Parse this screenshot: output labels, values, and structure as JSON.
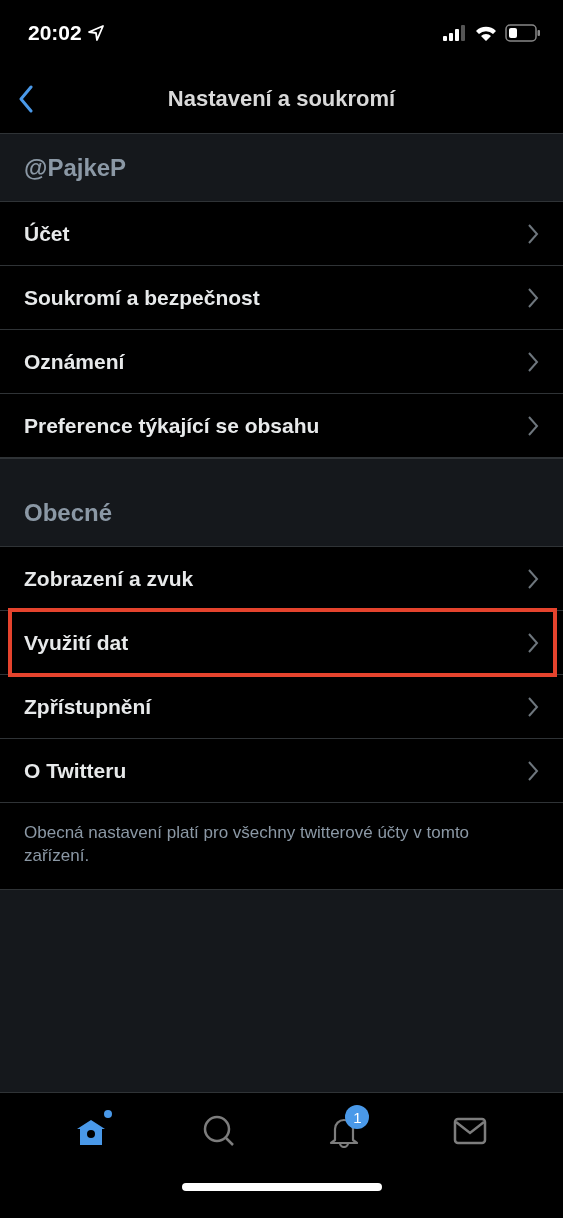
{
  "status_bar": {
    "time": "20:02"
  },
  "nav": {
    "title": "Nastavení a soukromí"
  },
  "sections": [
    {
      "header": "@PajkeP",
      "items": [
        {
          "label": "Účet",
          "highlighted": false
        },
        {
          "label": "Soukromí a bezpečnost",
          "highlighted": false
        },
        {
          "label": "Oznámení",
          "highlighted": false
        },
        {
          "label": "Preference týkající se obsahu",
          "highlighted": false
        }
      ]
    },
    {
      "header": "Obecné",
      "items": [
        {
          "label": "Zobrazení a zvuk",
          "highlighted": false
        },
        {
          "label": "Využití dat",
          "highlighted": true
        },
        {
          "label": "Zpřístupnění",
          "highlighted": false
        },
        {
          "label": "O Twitteru",
          "highlighted": false
        }
      ],
      "footer": "Obecná nastavení platí pro všechny twitterové účty v tomto zařízení."
    }
  ],
  "tab_bar": [
    {
      "kind": "home",
      "selected": true,
      "dot": true
    },
    {
      "kind": "search",
      "selected": false
    },
    {
      "kind": "notifications",
      "selected": false,
      "badge": "1"
    },
    {
      "kind": "messages",
      "selected": false
    }
  ]
}
